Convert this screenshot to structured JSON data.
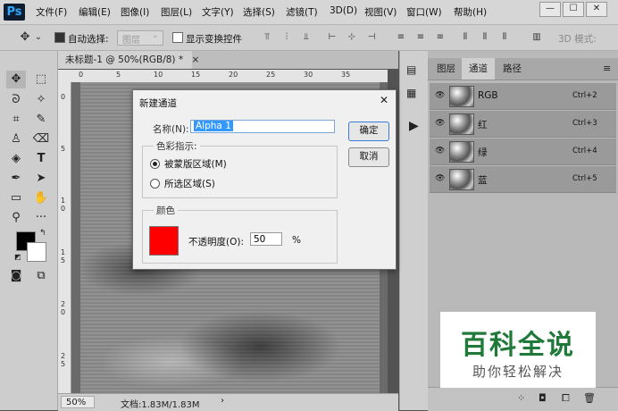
{
  "app": {
    "logo": "Ps"
  },
  "menu": [
    "文件(F)",
    "编辑(E)",
    "图像(I)",
    "图层(L)",
    "文字(Y)",
    "选择(S)",
    "滤镜(T)",
    "3D(D)",
    "视图(V)",
    "窗口(W)",
    "帮助(H)"
  ],
  "window_controls": {
    "minimize": "—",
    "maximize": "☐",
    "close": "✕"
  },
  "options_bar": {
    "auto_select_label": "自动选择:",
    "auto_select_checked": true,
    "auto_select_target": "图层",
    "show_transform_label": "显示变换控件",
    "show_transform_checked": false,
    "mode_3d_label": "3D 模式:"
  },
  "document": {
    "tab_title": "未标题-1 @ 50%(RGB/8) *",
    "tab_close": "×",
    "zoom": "50%",
    "doc_info": "文档:1.83M/1.83M",
    "ruler_top": [
      "0",
      "5",
      "10",
      "15",
      "20",
      "25",
      "30",
      "35"
    ],
    "ruler_left": [
      "0",
      "5",
      "1 0",
      "1 5",
      "2 0",
      "2 5"
    ]
  },
  "panel": {
    "tabs": [
      "图层",
      "通道",
      "路径"
    ],
    "active_tab": "通道",
    "channels": [
      {
        "name": "RGB",
        "shortcut": "Ctrl+2"
      },
      {
        "name": "红",
        "shortcut": "Ctrl+3"
      },
      {
        "name": "绿",
        "shortcut": "Ctrl+4"
      },
      {
        "name": "蓝",
        "shortcut": "Ctrl+5"
      }
    ]
  },
  "dialog": {
    "title": "新建通道",
    "close": "✕",
    "name_label": "名称(N):",
    "name_value": "Alpha 1",
    "ok": "确定",
    "cancel": "取消",
    "color_indicates_legend": "色彩指示:",
    "option_masked": "被蒙版区域(M)",
    "option_selected": "所选区域(S)",
    "selected_option": "masked",
    "color_legend": "颜色",
    "color_value": "#ff0000",
    "opacity_label": "不透明度(O):",
    "opacity_value": "50",
    "opacity_unit": "%"
  },
  "watermark": {
    "title": "百科全说",
    "subtitle": "助你轻松解决"
  },
  "colors": {
    "foreground": "#000000",
    "background": "#ffffff",
    "accent": "#3399ff"
  }
}
